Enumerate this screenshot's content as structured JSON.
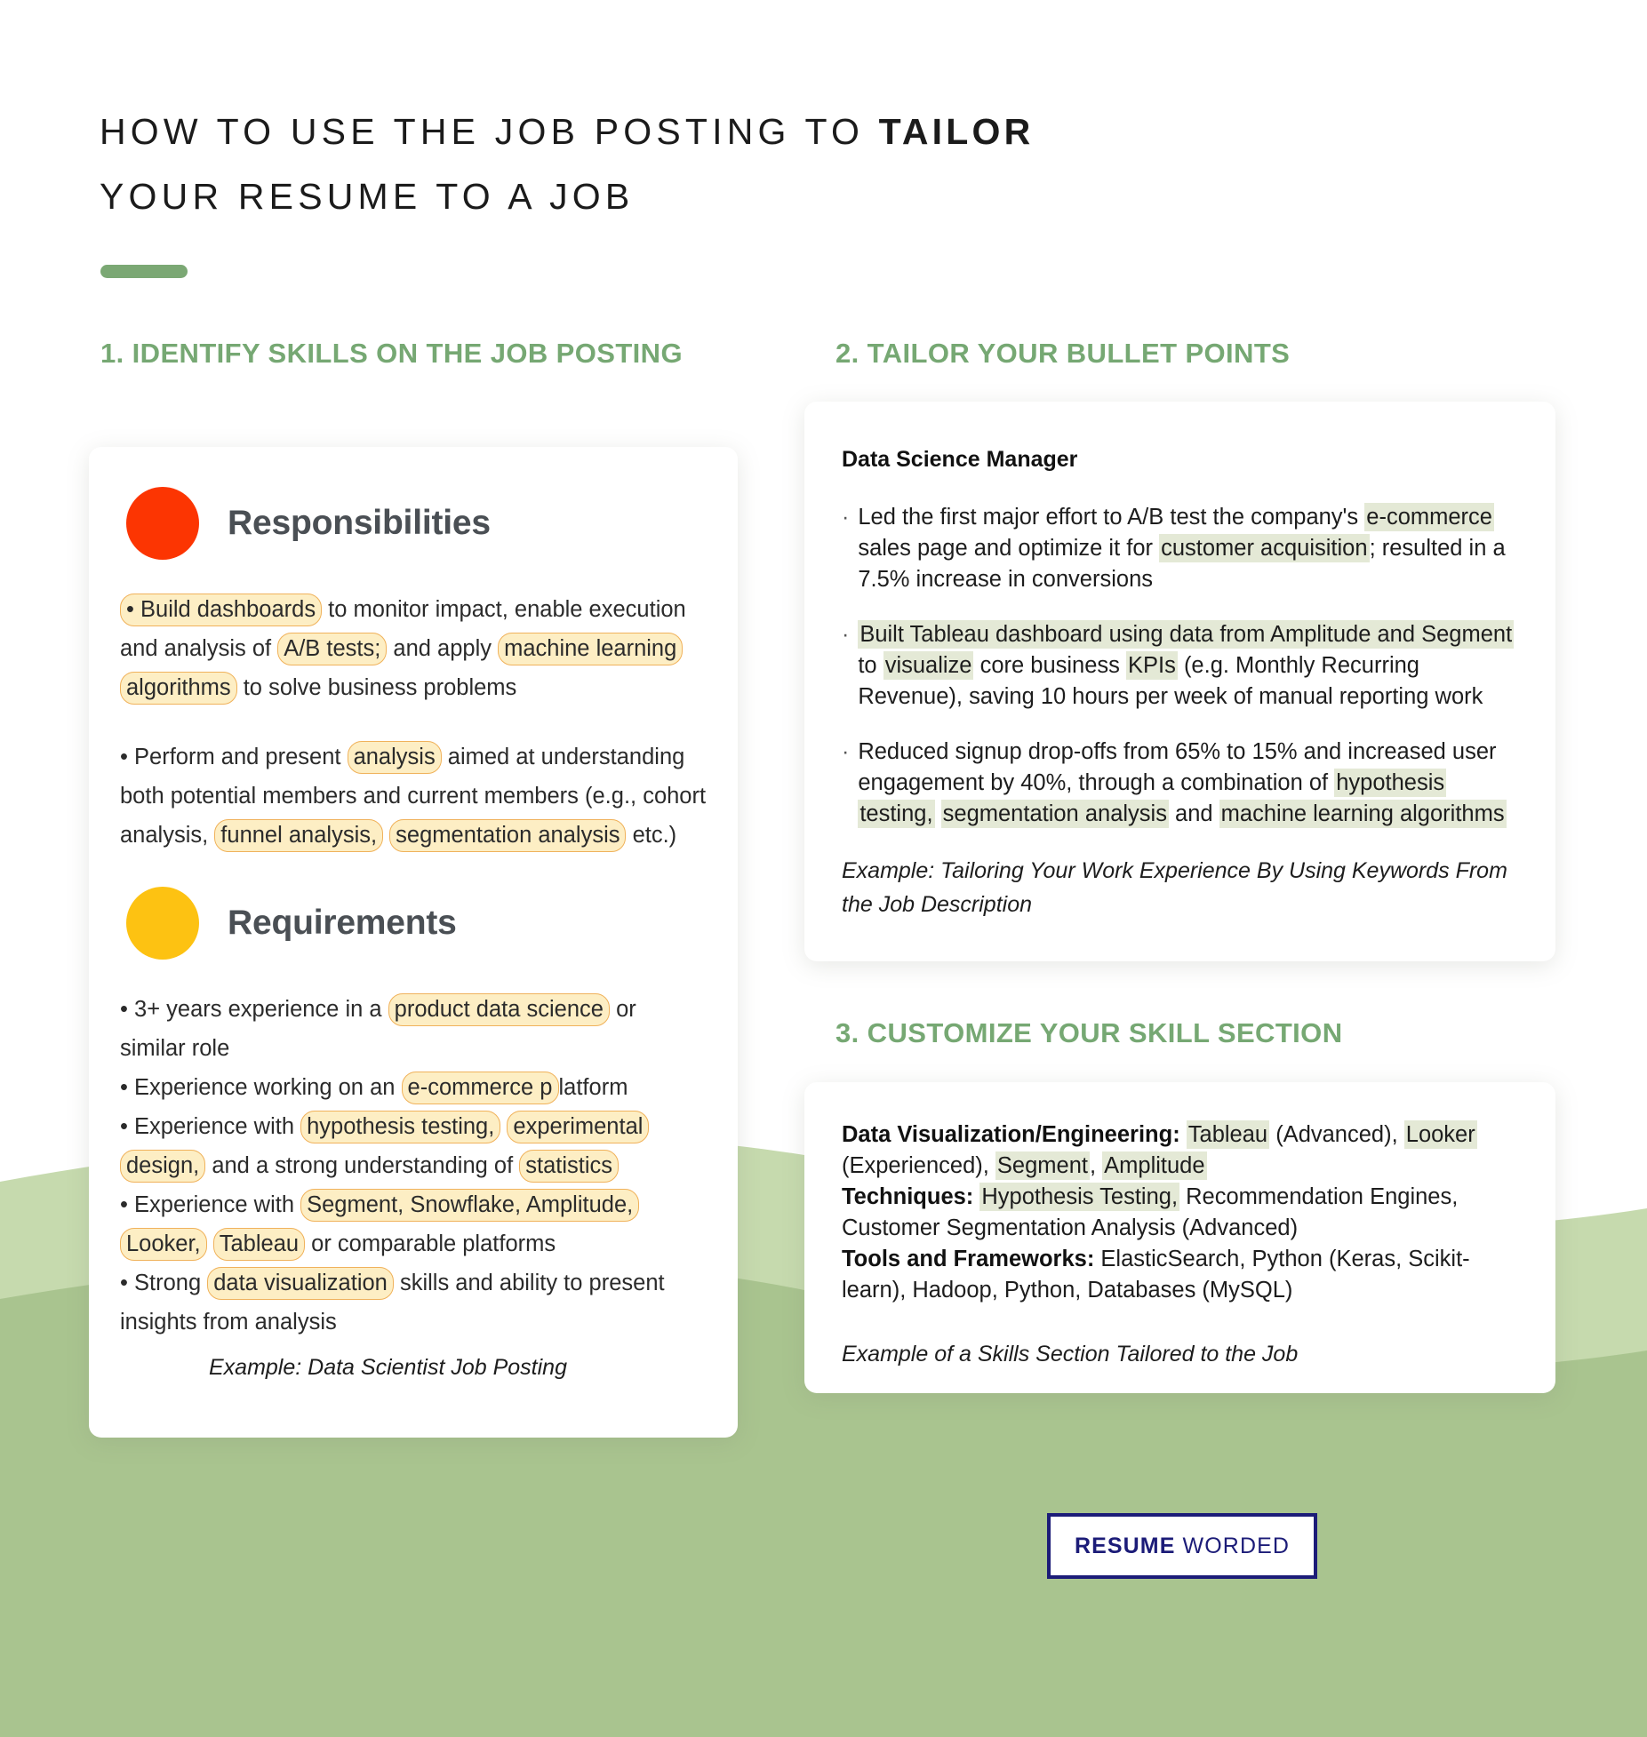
{
  "title": {
    "line1_plain": "HOW TO USE THE JOB POSTING TO ",
    "line1_bold": "TAILOR",
    "line2": "YOUR RESUME TO A JOB"
  },
  "colors": {
    "accent_green": "#7ba874",
    "heading_green": "#76a873",
    "wave_light": "#c6daae",
    "wave_dark": "#a9c48f",
    "dot_red": "#fc3502",
    "dot_yellow": "#fdc212",
    "highlight_orange_fill": "#fdeec4",
    "highlight_orange_border": "#f0b25c",
    "highlight_green_fill": "#e4e9d6",
    "logo_navy": "#1c1c78"
  },
  "sections": {
    "one": {
      "heading": "1. IDENTIFY SKILLS ON THE JOB POSTING"
    },
    "two": {
      "heading": "2. TAILOR YOUR BULLET POINTS"
    },
    "three": {
      "heading": "3. CUSTOMIZE YOUR SKILL SECTION"
    }
  },
  "job_posting_card": {
    "responsibilities": {
      "label": "Responsibilities",
      "bullet_marker": "•",
      "items": [
        [
          {
            "t": "• Build dashboards",
            "hl": "orange"
          },
          {
            "t": " to monitor impact, enable execution and analysis of ",
            "hl": "none"
          },
          {
            "t": "A/B tests;",
            "hl": "orange"
          },
          {
            "t": " and apply ",
            "hl": "none"
          },
          {
            "t": "machine learning algorithms",
            "hl": "orange"
          },
          {
            "t": " to solve business problems",
            "hl": "none"
          }
        ],
        [
          {
            "t": "• Perform and present ",
            "hl": "none"
          },
          {
            "t": "analysis",
            "hl": "orange"
          },
          {
            "t": " aimed at understanding both potential members and current members (e.g., cohort analysis, ",
            "hl": "none"
          },
          {
            "t": "funnel analysis,",
            "hl": "orange"
          },
          {
            "t": " ",
            "hl": "none"
          },
          {
            "t": "segmentation analysis",
            "hl": "orange"
          },
          {
            "t": " etc.)",
            "hl": "none"
          }
        ]
      ]
    },
    "requirements": {
      "label": "Requirements",
      "items": [
        [
          {
            "t": "• 3+ years experience in a ",
            "hl": "none"
          },
          {
            "t": "product data science",
            "hl": "orange"
          },
          {
            "t": " or similar role",
            "hl": "none"
          }
        ],
        [
          {
            "t": "• Experience working on an ",
            "hl": "none"
          },
          {
            "t": "e-commerce p",
            "hl": "orange"
          },
          {
            "t": "latform",
            "hl": "none"
          }
        ],
        [
          {
            "t": "• Experience with ",
            "hl": "none"
          },
          {
            "t": "hypothesis testing,",
            "hl": "orange"
          },
          {
            "t": " ",
            "hl": "none"
          },
          {
            "t": "experimental design,",
            "hl": "orange"
          },
          {
            "t": " and a strong understanding of ",
            "hl": "none"
          },
          {
            "t": "statistics",
            "hl": "orange"
          }
        ],
        [
          {
            "t": "• Experience with ",
            "hl": "none"
          },
          {
            "t": "Segment, Snowflake, Amplitude, Looker,",
            "hl": "orange"
          },
          {
            "t": " ",
            "hl": "none"
          },
          {
            "t": "Tableau",
            "hl": "orange"
          },
          {
            "t": " or comparable platforms",
            "hl": "none"
          }
        ],
        [
          {
            "t": "• Strong ",
            "hl": "none"
          },
          {
            "t": "data visualization",
            "hl": "orange"
          },
          {
            "t": " skills and ability to present insights from analysis",
            "hl": "none"
          }
        ]
      ]
    },
    "example_caption": "Example: Data Scientist Job Posting"
  },
  "bullets_card": {
    "job_title": "Data Science Manager",
    "bullet_marker": "·",
    "bullets": [
      [
        {
          "t": "Led the first major effort to A/B test the company's ",
          "hl": "none"
        },
        {
          "t": "e-commerce",
          "hl": "green"
        },
        {
          "t": " sales page and optimize it for ",
          "hl": "none"
        },
        {
          "t": "customer acquisition",
          "hl": "green"
        },
        {
          "t": "; resulted in a 7.5% increase in conversions",
          "hl": "none"
        }
      ],
      [
        {
          "t": "Built Tableau dashboard using data from Amplitude and Segment",
          "hl": "green"
        },
        {
          "t": " to ",
          "hl": "none"
        },
        {
          "t": "visualize",
          "hl": "green"
        },
        {
          "t": " core business ",
          "hl": "none"
        },
        {
          "t": "KPIs",
          "hl": "green"
        },
        {
          "t": " (e.g. Monthly Recurring Revenue), saving 10 hours per week of manual reporting work",
          "hl": "none"
        }
      ],
      [
        {
          "t": "Reduced signup drop-offs from 65% to 15% and increased user engagement by 40%, through a combination of ",
          "hl": "none"
        },
        {
          "t": "hypothesis testing,",
          "hl": "green"
        },
        {
          "t": " ",
          "hl": "none"
        },
        {
          "t": "segmentation analysis",
          "hl": "green"
        },
        {
          "t": " and ",
          "hl": "none"
        },
        {
          "t": "machine learning algorithms",
          "hl": "green"
        }
      ]
    ],
    "example_caption": "Example: Tailoring Your Work Experience By Using Keywords From the Job Description"
  },
  "skills_card": {
    "lines": [
      [
        {
          "t": "Data Visualization/Engineering:",
          "hl": "label"
        },
        {
          "t": " ",
          "hl": "none"
        },
        {
          "t": "Tableau",
          "hl": "green"
        },
        {
          "t": " (Advanced), ",
          "hl": "none"
        },
        {
          "t": "Looker",
          "hl": "green"
        },
        {
          "t": " (Experienced), ",
          "hl": "none"
        },
        {
          "t": "Segment",
          "hl": "green"
        },
        {
          "t": ", ",
          "hl": "none"
        },
        {
          "t": "Amplitude",
          "hl": "green"
        }
      ],
      [
        {
          "t": "Techniques:",
          "hl": "label"
        },
        {
          "t": " ",
          "hl": "none"
        },
        {
          "t": "Hypothesis Testing,",
          "hl": "green"
        },
        {
          "t": " Recommendation Engines, Customer Segmentation Analysis (Advanced)",
          "hl": "none"
        }
      ],
      [
        {
          "t": "Tools and Frameworks:",
          "hl": "label"
        },
        {
          "t": " ElasticSearch, Python (Keras, Scikit-learn), Hadoop, Python, Databases (MySQL)",
          "hl": "none"
        }
      ]
    ],
    "example_caption": "Example of a Skills Section Tailored to the Job"
  },
  "logo": {
    "bold_part": "RESUME",
    "light_part": " WORDED"
  }
}
